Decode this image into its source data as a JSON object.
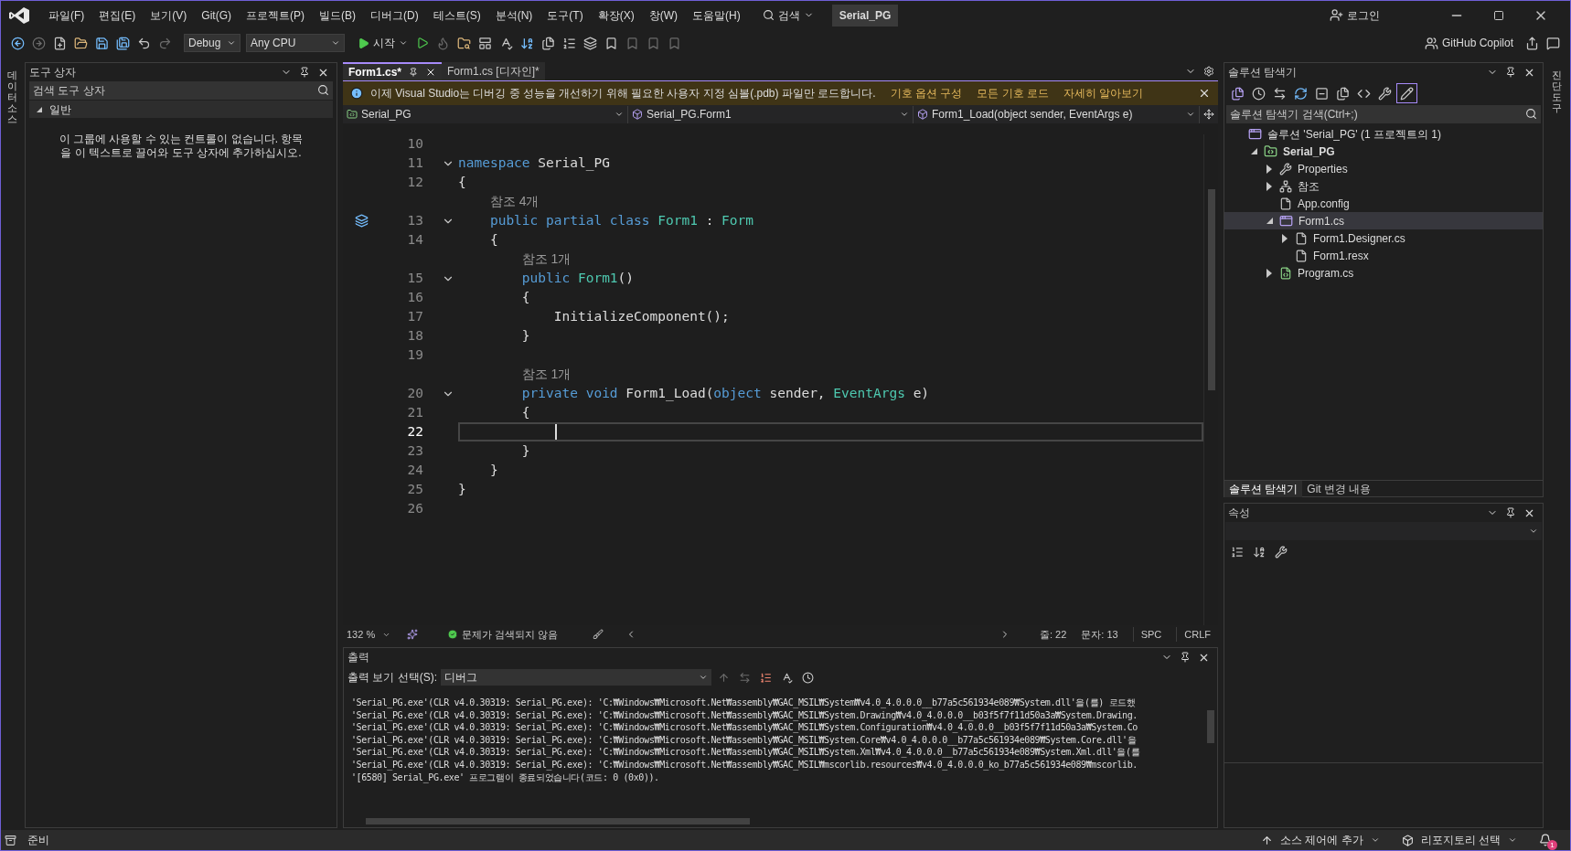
{
  "menu_bar": {
    "items": [
      "파일(F)",
      "편집(E)",
      "보기(V)",
      "Git(G)",
      "프로젝트(P)",
      "빌드(B)",
      "디버그(D)",
      "테스트(S)",
      "분석(N)",
      "도구(T)",
      "확장(X)",
      "창(W)",
      "도움말(H)"
    ],
    "search": "검색",
    "solution_name": "Serial_PG",
    "login": "로그인"
  },
  "toolbar": {
    "configuration": "Debug",
    "platform": "Any CPU",
    "start": "시작",
    "copilot": "GitHub Copilot"
  },
  "side_strips": {
    "left": "데이터 소스",
    "right": "진단 도구"
  },
  "toolbox": {
    "title": "도구 상자",
    "search": {
      "placeholder": "검색 도구 상자"
    },
    "group": {
      "label": "일반",
      "expanded": true
    },
    "message": "이 그룹에 사용할 수 있는 컨트롤이 없습니다. 항목을 이 텍스트로 끌어와 도구 상자에 추가하십시오."
  },
  "editor": {
    "tabs": [
      {
        "label": "Form1.cs*",
        "selected": true
      },
      {
        "label": "Form1.cs [디자인]*",
        "selected": false
      }
    ],
    "info_bar": {
      "message": "이제 Visual Studio는 디버깅 중 성능을 개선하기 위해 필요한 사용자 지정 심볼(.pdb) 파일만 로드합니다.",
      "links": [
        "기호 옵션 구성",
        "모든 기호 로드",
        "자세히 알아보기"
      ]
    },
    "navigation": [
      "Serial_PG",
      "Serial_PG.Form1",
      "Form1_Load(object sender, EventArgs e)"
    ],
    "lines": [
      {
        "number": "10",
        "foldable": false,
        "current": false,
        "margin_glyph": false
      },
      {
        "number": "11",
        "foldable": true,
        "current": false,
        "margin_glyph": false,
        "segments": [
          {
            "kind": "keyword",
            "text": "namespace "
          },
          {
            "kind": "plain",
            "text": "Serial_PG"
          }
        ]
      },
      {
        "number": "12",
        "foldable": false,
        "current": false,
        "margin_glyph": false,
        "segments": [
          {
            "kind": "plain",
            "text": "{"
          }
        ]
      },
      {
        "number": "13",
        "foldable": true,
        "current": false,
        "margin_glyph": true,
        "codelens": "참조 4개",
        "segments": [
          {
            "kind": "keyword",
            "text": "    public partial class "
          },
          {
            "kind": "type",
            "text": "Form1"
          },
          {
            "kind": "plain",
            "text": " : "
          },
          {
            "kind": "type",
            "text": "Form"
          }
        ]
      },
      {
        "number": "14",
        "foldable": false,
        "current": false,
        "margin_glyph": false,
        "segments": [
          {
            "kind": "plain",
            "text": "    {"
          }
        ]
      },
      {
        "number": "15",
        "foldable": true,
        "current": false,
        "margin_glyph": false,
        "codelens": "참조 1개",
        "segments": [
          {
            "kind": "keyword",
            "text": "        public "
          },
          {
            "kind": "type",
            "text": "Form1"
          },
          {
            "kind": "plain",
            "text": "()"
          }
        ]
      },
      {
        "number": "16",
        "foldable": false,
        "current": false,
        "margin_glyph": false,
        "segments": [
          {
            "kind": "plain",
            "text": "        {"
          }
        ]
      },
      {
        "number": "17",
        "foldable": false,
        "current": false,
        "margin_glyph": false,
        "segments": [
          {
            "kind": "plain",
            "text": "            InitializeComponent();"
          }
        ]
      },
      {
        "number": "18",
        "foldable": false,
        "current": false,
        "margin_glyph": false,
        "segments": [
          {
            "kind": "plain",
            "text": "        }"
          }
        ]
      },
      {
        "number": "19",
        "foldable": false,
        "current": false,
        "margin_glyph": false
      },
      {
        "number": "20",
        "foldable": true,
        "current": false,
        "margin_glyph": false,
        "codelens": "참조 1개",
        "segments": [
          {
            "kind": "keyword",
            "text": "        private void "
          },
          {
            "kind": "plain",
            "text": "Form1_Load("
          },
          {
            "kind": "keyword",
            "text": "object"
          },
          {
            "kind": "plain",
            "text": " sender, "
          },
          {
            "kind": "type",
            "text": "EventArgs"
          },
          {
            "kind": "plain",
            "text": " e)"
          }
        ]
      },
      {
        "number": "21",
        "foldable": false,
        "current": false,
        "margin_glyph": false,
        "segments": [
          {
            "kind": "plain",
            "text": "        {"
          }
        ]
      },
      {
        "number": "22",
        "foldable": false,
        "current": true,
        "margin_glyph": false
      },
      {
        "number": "23",
        "foldable": false,
        "current": false,
        "margin_glyph": false,
        "segments": [
          {
            "kind": "plain",
            "text": "        }"
          }
        ]
      },
      {
        "number": "24",
        "foldable": false,
        "current": false,
        "margin_glyph": false,
        "segments": [
          {
            "kind": "plain",
            "text": "    }"
          }
        ]
      },
      {
        "number": "25",
        "foldable": false,
        "current": false,
        "margin_glyph": false,
        "segments": [
          {
            "kind": "plain",
            "text": "}"
          }
        ]
      },
      {
        "number": "26",
        "foldable": false,
        "current": false,
        "margin_glyph": false
      }
    ],
    "status": {
      "zoom": "132 %",
      "issues": "문제가 검색되지 않음",
      "line": "줄: 22",
      "column": "문자: 13",
      "whitespace": "SPC",
      "line_ending": "CRLF"
    }
  },
  "output": {
    "title": "출력",
    "source_label": "출력 보기 선택(S):",
    "source": "디버그",
    "lines": [
      "'Serial_PG.exe'(CLR v4.0.30319: Serial_PG.exe): 'C:₩Windows₩Microsoft.Net₩assembly₩GAC_MSIL₩System₩v4.0_4.0.0.0__b77a5c561934e089₩System.dll'을(를) 로드했",
      "'Serial_PG.exe'(CLR v4.0.30319: Serial_PG.exe): 'C:₩Windows₩Microsoft.Net₩assembly₩GAC_MSIL₩System.Drawing₩v4.0_4.0.0.0__b03f5f7f11d50a3a₩System.Drawing.",
      "'Serial_PG.exe'(CLR v4.0.30319: Serial_PG.exe): 'C:₩Windows₩Microsoft.Net₩assembly₩GAC_MSIL₩System.Configuration₩v4.0_4.0.0.0__b03f5f7f11d50a3a₩System.Co",
      "'Serial_PG.exe'(CLR v4.0.30319: Serial_PG.exe): 'C:₩Windows₩Microsoft.Net₩assembly₩GAC_MSIL₩System.Core₩v4.0_4.0.0.0__b77a5c561934e089₩System.Core.dll'을",
      "'Serial_PG.exe'(CLR v4.0.30319: Serial_PG.exe): 'C:₩Windows₩Microsoft.Net₩assembly₩GAC_MSIL₩System.Xml₩v4.0_4.0.0.0__b77a5c561934e089₩System.Xml.dll'을(를",
      "'Serial_PG.exe'(CLR v4.0.30319: Serial_PG.exe): 'C:₩Windows₩Microsoft.Net₩assembly₩GAC_MSIL₩mscorlib.resources₩v4.0_4.0.0.0_ko_b77a5c561934e089₩mscorlib.",
      "'[6580] Serial_PG.exe' 프로그램이 종료되었습니다(코드: 0 (0x0))."
    ]
  },
  "solution_explorer": {
    "title": "솔루션 탐색기",
    "search": {
      "placeholder": "솔루션 탐색기 검색(Ctrl+;)"
    },
    "tree": [
      {
        "label": "솔루션 'Serial_PG' (1 프로젝트의 1)",
        "kind": "solution",
        "selected": false,
        "children": [
          {
            "label": "Serial_PG",
            "kind": "project",
            "expandable": true,
            "expanded": true,
            "selected": false,
            "children": [
              {
                "label": "Properties",
                "kind": "properties",
                "expandable": true,
                "expanded": false,
                "selected": false
              },
              {
                "label": "참조",
                "kind": "references",
                "expandable": true,
                "expanded": false,
                "selected": false
              },
              {
                "label": "App.config",
                "kind": "config",
                "expandable": false,
                "expanded": false,
                "selected": false
              },
              {
                "label": "Form1.cs",
                "kind": "form",
                "expandable": true,
                "expanded": true,
                "selected": true,
                "children": [
                  {
                    "label": "Form1.Designer.cs",
                    "kind": "file",
                    "expandable": true,
                    "expanded": false,
                    "selected": false
                  },
                  {
                    "label": "Form1.resx",
                    "kind": "file",
                    "expandable": false,
                    "expanded": false,
                    "selected": false
                  }
                ]
              },
              {
                "label": "Program.cs",
                "kind": "csharp",
                "expandable": true,
                "expanded": false,
                "selected": false
              }
            ]
          }
        ]
      }
    ],
    "tabs": [
      {
        "label": "솔루션 탐색기",
        "selected": true
      },
      {
        "label": "Git 변경 내용",
        "selected": false
      }
    ]
  },
  "properties": {
    "title": "속성"
  },
  "status_bar": {
    "status": "준비",
    "source_control": "소스 제어에 추가",
    "repository": "리포지토리 선택",
    "notifications": "1"
  }
}
